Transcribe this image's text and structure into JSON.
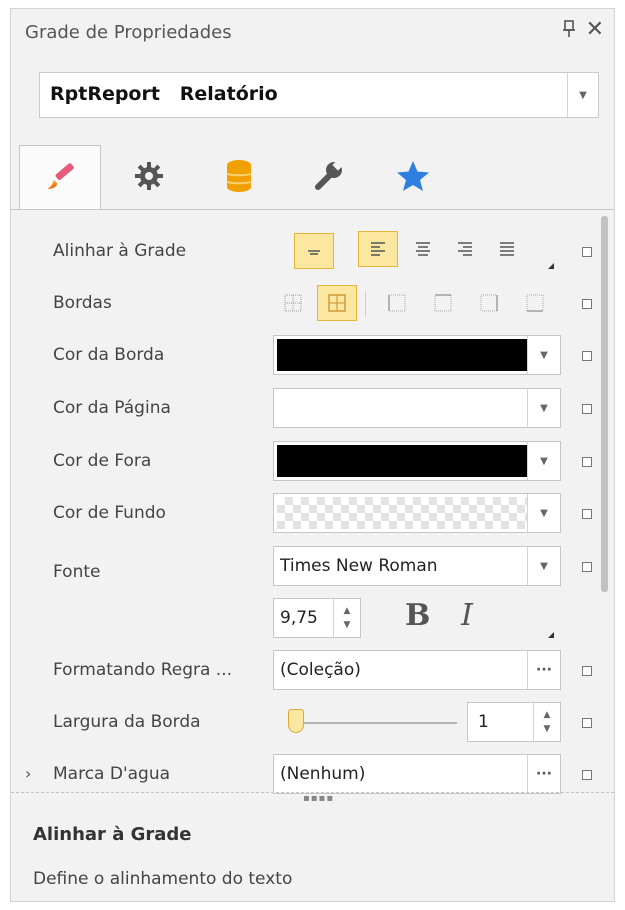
{
  "panel": {
    "title": "Grade de Propriedades",
    "pin_icon": "pin-icon",
    "close_icon": "close-icon"
  },
  "object_selector": {
    "value": "RptReport   Relatório"
  },
  "tabs": [
    {
      "icon": "brush-icon",
      "active": true
    },
    {
      "icon": "gear-icon",
      "active": false
    },
    {
      "icon": "database-icon",
      "active": false
    },
    {
      "icon": "wrench-icon",
      "active": false
    },
    {
      "icon": "star-icon",
      "active": false
    }
  ],
  "properties": {
    "align": {
      "label": "Alinhar à Grade"
    },
    "borders": {
      "label": "Bordas"
    },
    "border_color": {
      "label": "Cor da Borda",
      "color": "#000000"
    },
    "page_color": {
      "label": "Cor da Página",
      "color": "#ffffff"
    },
    "outer_color": {
      "label": "Cor de Fora",
      "color": "#000000"
    },
    "back_color": {
      "label": "Cor de Fundo",
      "color": "transparent"
    },
    "font": {
      "label": "Fonte",
      "value": "Times New Roman",
      "size": "9,75",
      "bold_glyph": "B",
      "italic_glyph": "I"
    },
    "format_rule": {
      "label": "Formatando Regra ...",
      "value": "(Coleção)",
      "button": "···"
    },
    "border_width": {
      "label": "Largura da Borda",
      "value": "1",
      "slider_fraction": 0.0
    },
    "watermark": {
      "label": "Marca D'agua",
      "value": "(Nenhum)",
      "button": "···"
    }
  },
  "description": {
    "title": "Alinhar à Grade",
    "text": "Define o alinhamento do texto"
  },
  "colors": {
    "accent_fill": "#fbe7a0",
    "accent_border": "#e2b73a"
  }
}
